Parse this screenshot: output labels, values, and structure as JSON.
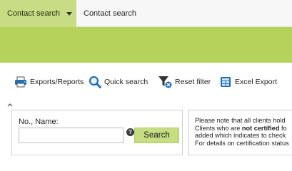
{
  "tabs": {
    "active_label": "Contact search",
    "inactive_label": "Contact search"
  },
  "toolbar": {
    "exports_label": "Exports/Reports",
    "quick_search_label": "Quick search",
    "reset_filter_label": "Reset filter",
    "excel_export_label": "Excel Export"
  },
  "search": {
    "field_label": "No., Name:",
    "input_value": "",
    "help_glyph": "?",
    "button_label": "Search"
  },
  "notice": {
    "line1": "Please note that all clients hold",
    "line2_pre": "Clients who are ",
    "line2_bold": "not certified",
    "line2_post": " fo",
    "line3": "added which indicates to check",
    "line4": "For details on certification status"
  },
  "icons": {
    "exports": "printer-icon",
    "quick_search": "magnifier-icon",
    "reset_filter": "funnel-reset-icon",
    "excel_export": "excel-icon",
    "collapse": "chevron-up-icon",
    "tab_dropdown": "caret-down-icon",
    "help": "help-icon"
  },
  "colors": {
    "tab_active_bg": "#c7dc83",
    "band_bg": "#b5d35a",
    "search_button_bg": "#c7dd82",
    "tool_icon_blue": "#1f6fb5"
  }
}
